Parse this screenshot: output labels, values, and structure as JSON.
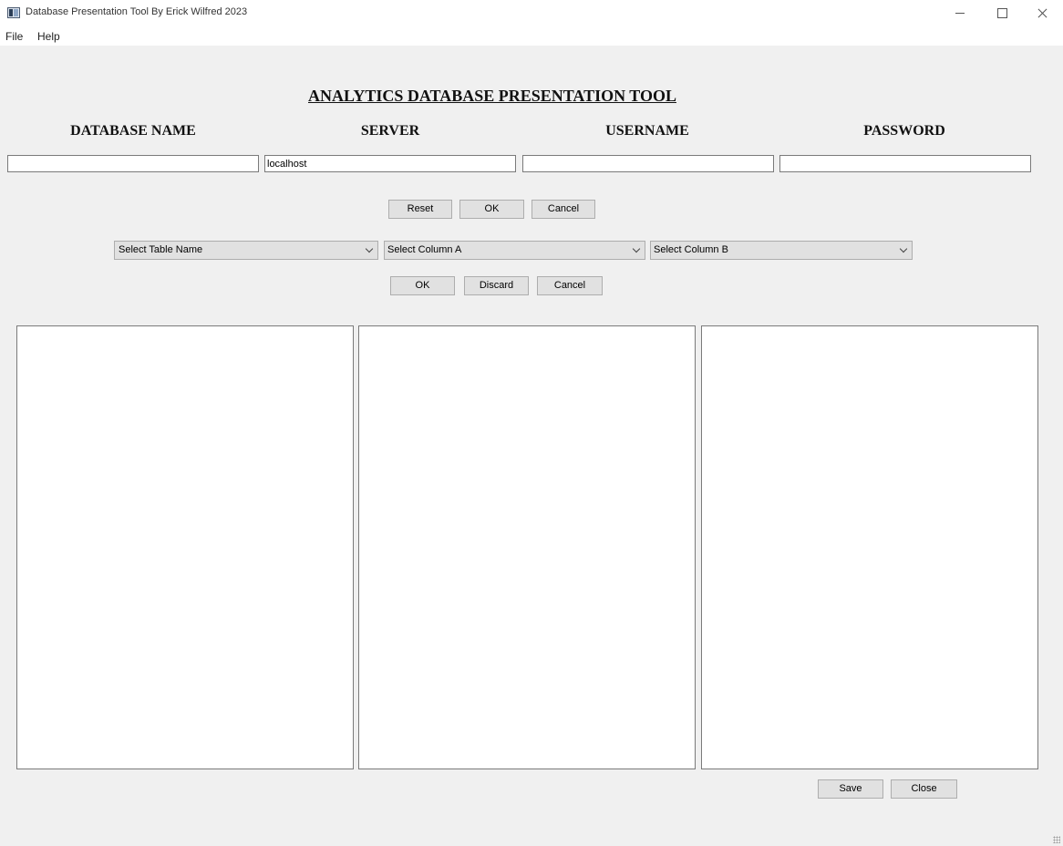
{
  "window": {
    "title": "Database Presentation Tool By Erick Wilfred 2023",
    "icon": "app-window-icon"
  },
  "menu": {
    "file": "File",
    "help": "Help"
  },
  "header": {
    "title": "ANALYTICS DATABASE  PRESENTATION TOOL"
  },
  "connection": {
    "database_label": "DATABASE NAME",
    "server_label": "SERVER",
    "username_label": "USERNAME",
    "password_label": "PASSWORD",
    "database_value": "",
    "server_value": "localhost",
    "username_value": "",
    "password_value": "",
    "reset_label": "Reset",
    "ok_label": "OK",
    "cancel_label": "Cancel"
  },
  "selection": {
    "table_selected": "Select Table Name",
    "column_a_selected": "Select Column A",
    "column_b_selected": "Select Column B",
    "ok_label": "OK",
    "discard_label": "Discard",
    "cancel_label": "Cancel"
  },
  "footer": {
    "save_label": "Save",
    "close_label": "Close"
  }
}
